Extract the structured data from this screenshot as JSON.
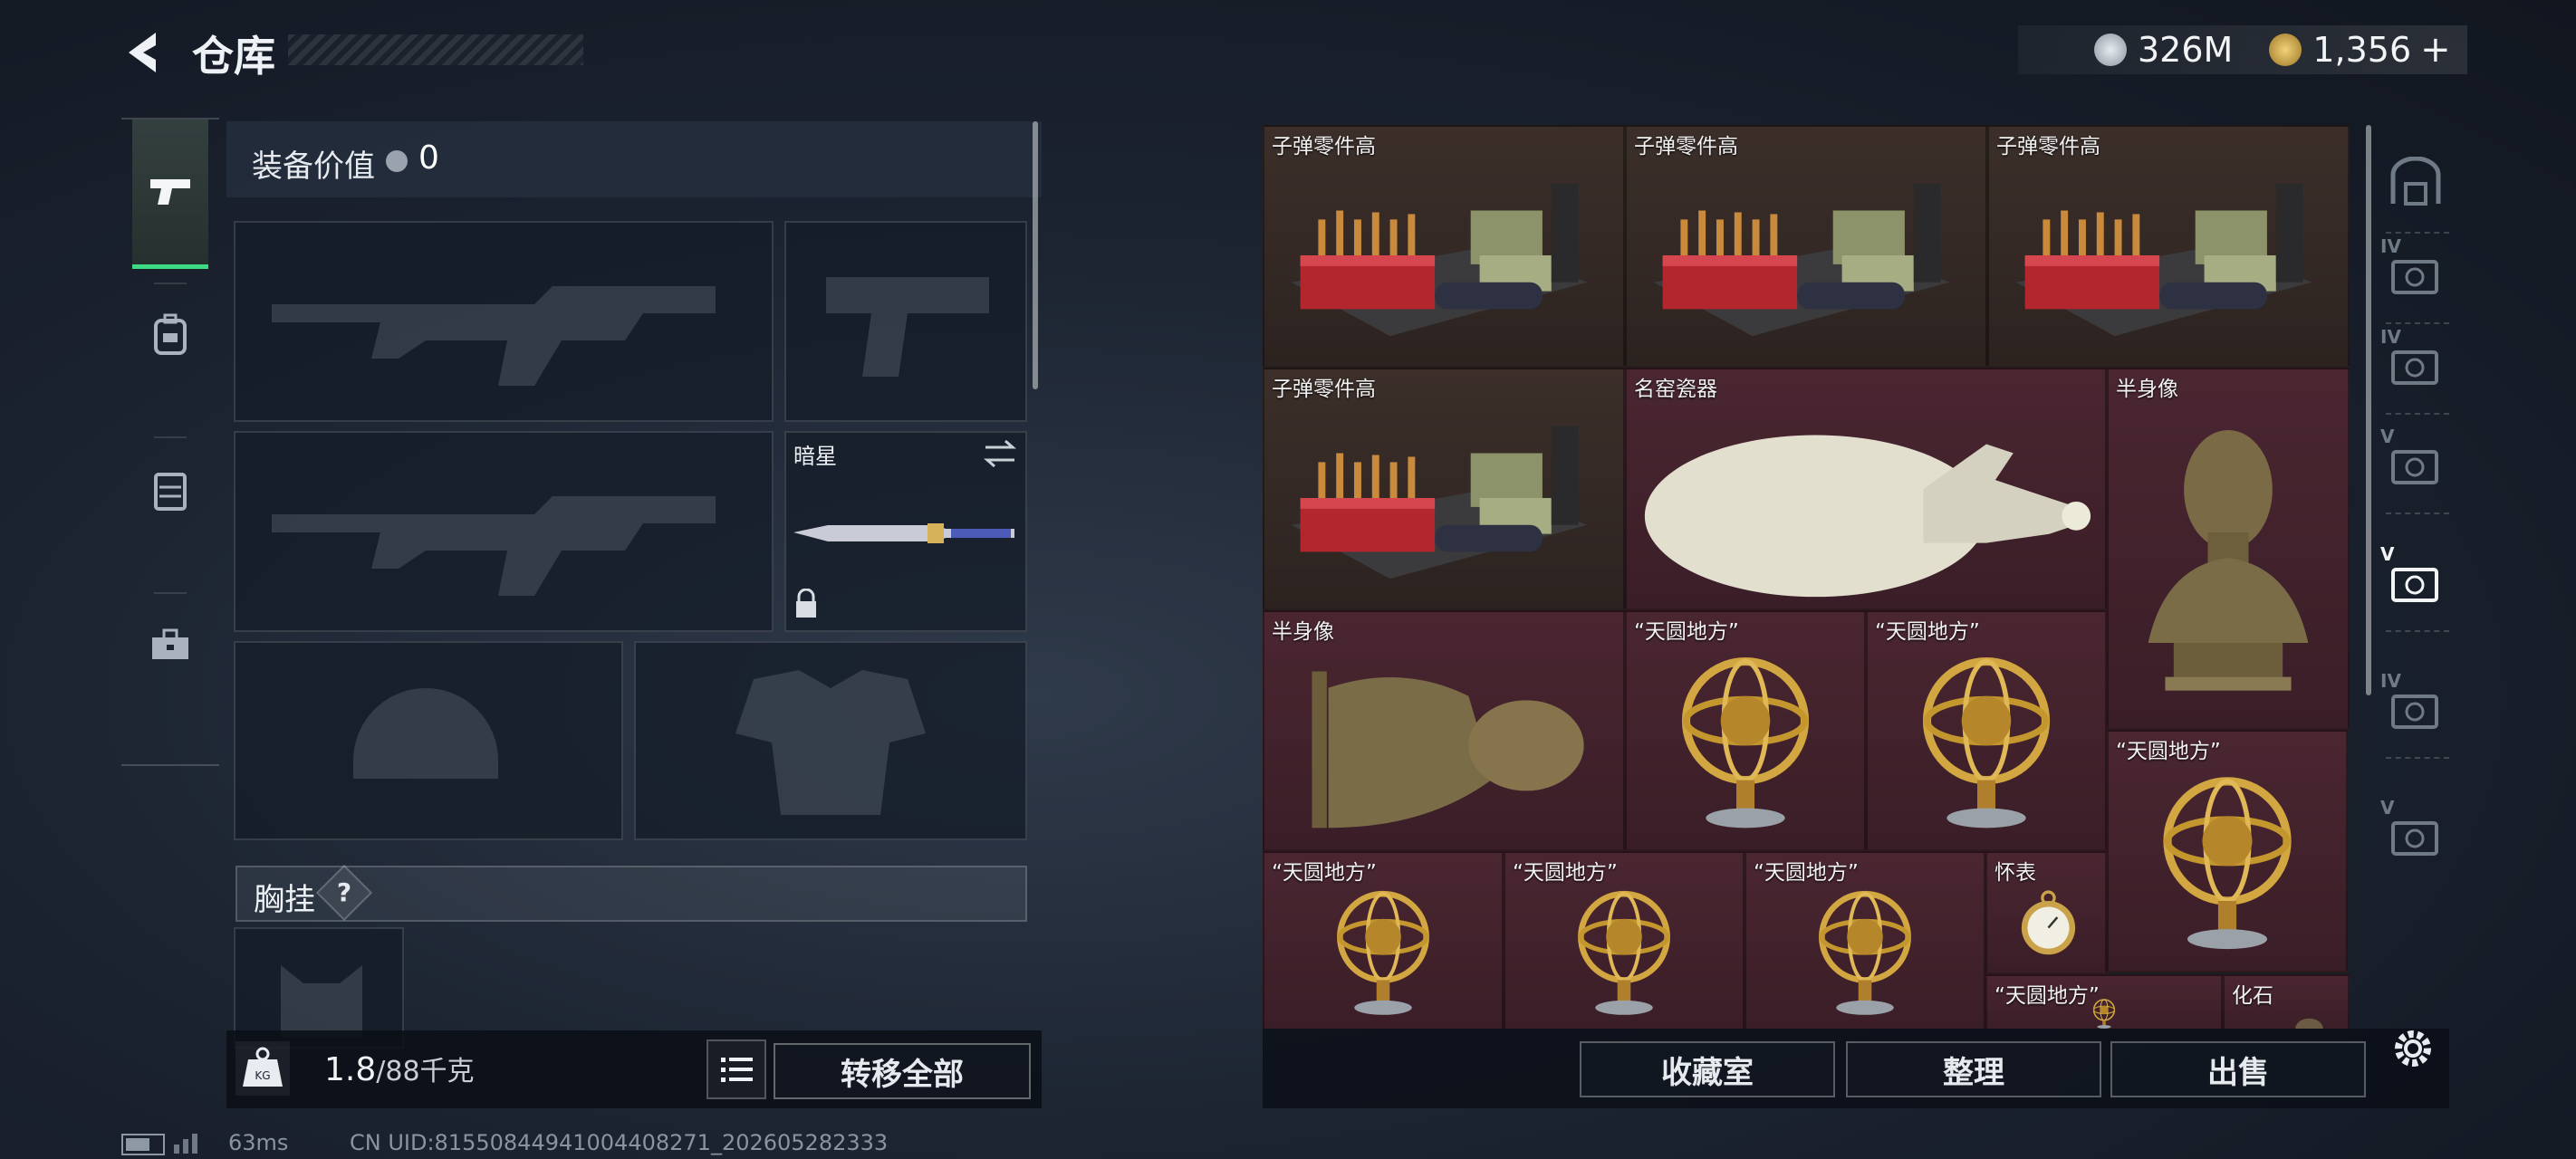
{
  "header": {
    "title": "仓库",
    "currency": [
      {
        "name": "silver-coin-icon",
        "value": "326M",
        "color": "#b9c2cc"
      },
      {
        "name": "gold-coin-icon",
        "value": "1,356",
        "color": "#c9a14a"
      }
    ],
    "add_label": "+"
  },
  "left_nav": {
    "items": [
      {
        "icon": "pistol-icon",
        "active": true
      },
      {
        "icon": "backpack-icon",
        "active": false
      },
      {
        "icon": "vest-icon",
        "active": false
      },
      {
        "icon": "toolbox-icon",
        "active": false
      }
    ],
    "active_color": "#3ddc84"
  },
  "equipment": {
    "value_label": "装备价值",
    "value": "0",
    "melee_slot": {
      "name": "暗星",
      "locked": true
    },
    "chest_label": "胸挂",
    "chest_help": "?"
  },
  "bottom_left": {
    "weight_current": "1.8",
    "weight_max": "/88千克",
    "weight_icon_label": "KG",
    "transfer_all": "转移全部"
  },
  "warehouse": {
    "items": [
      {
        "name": "子弹零件高",
        "kind": "ammo",
        "bg": "brown"
      },
      {
        "name": "子弹零件高",
        "kind": "ammo",
        "bg": "brown"
      },
      {
        "name": "子弹零件高",
        "kind": "ammo",
        "bg": "brown"
      },
      {
        "name": "子弹零件高",
        "kind": "ammo",
        "bg": "brown"
      },
      {
        "name": "名窑瓷器",
        "kind": "vase",
        "bg": "red"
      },
      {
        "name": "半身像",
        "kind": "bust",
        "bg": "red"
      },
      {
        "name": "半身像",
        "kind": "bust-side",
        "bg": "red"
      },
      {
        "name": "“天圆地方”",
        "kind": "sphere",
        "bg": "red"
      },
      {
        "name": "“天圆地方”",
        "kind": "sphere",
        "bg": "red"
      },
      {
        "name": "“天圆地方”",
        "kind": "sphere",
        "bg": "red"
      },
      {
        "name": "“天圆地方”",
        "kind": "sphere",
        "bg": "red"
      },
      {
        "name": "“天圆地方”",
        "kind": "sphere",
        "bg": "red"
      },
      {
        "name": "“天圆地方”",
        "kind": "sphere",
        "bg": "red"
      },
      {
        "name": "怀表",
        "kind": "watch",
        "bg": "red"
      },
      {
        "name": "“天圆地方”",
        "kind": "sphere",
        "bg": "red"
      },
      {
        "name": "化石",
        "kind": "fossil",
        "bg": "red"
      }
    ]
  },
  "right_nav": {
    "items": [
      {
        "icon": "safebox-icon"
      },
      {
        "icon": "tier-iv-item-icon",
        "label": "IV"
      },
      {
        "icon": "tier-iv-item-icon",
        "label": "IV"
      },
      {
        "icon": "tier-v-item-icon",
        "label": "V"
      },
      {
        "icon": "tier-v-item-icon",
        "label": "V",
        "active": true
      },
      {
        "icon": "tier-iv-item-icon",
        "label": "IV"
      },
      {
        "icon": "tier-v-item-icon",
        "label": "V"
      }
    ]
  },
  "actions": {
    "collection": "收藏室",
    "organize": "整理",
    "sell": "出售"
  },
  "status": {
    "ping": "63ms",
    "uid": "CN UID:81550844941004408271_202605282333"
  }
}
